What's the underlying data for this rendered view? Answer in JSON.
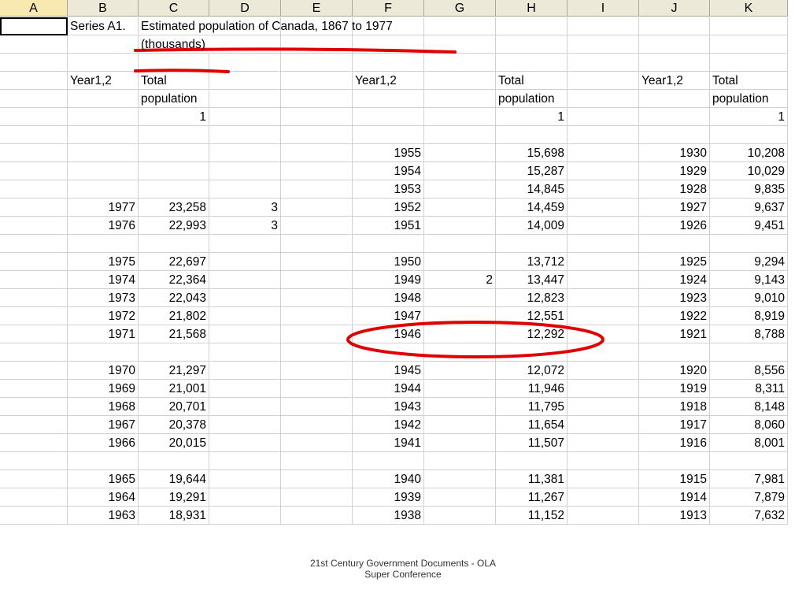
{
  "columns": [
    "A",
    "B",
    "C",
    "D",
    "E",
    "F",
    "G",
    "H",
    "I",
    "J",
    "K"
  ],
  "rows": [
    [
      "",
      "Series A1.",
      "Estimated population of Canada, 1867 to 1977",
      "",
      "",
      "",
      "",
      "",
      "",
      "",
      ""
    ],
    [
      "",
      "",
      "(thousands)",
      "",
      "",
      "",
      "",
      "",
      "",
      "",
      ""
    ],
    [
      "",
      "",
      "",
      "",
      "",
      "",
      "",
      "",
      "",
      "",
      ""
    ],
    [
      "",
      "Year1,2",
      "Total",
      "",
      "",
      "Year1,2",
      "",
      "Total",
      "",
      "Year1,2",
      "Total"
    ],
    [
      "",
      "",
      "population",
      "",
      "",
      "",
      "",
      "population",
      "",
      "",
      "population"
    ],
    [
      "",
      "",
      "1",
      "",
      "",
      "",
      "",
      "1",
      "",
      "",
      "1"
    ],
    [
      "",
      "",
      "",
      "",
      "",
      "",
      "",
      "",
      "",
      "",
      ""
    ],
    [
      "",
      "",
      "",
      "",
      "",
      "1955",
      "",
      "15,698",
      "",
      "1930",
      "10,208"
    ],
    [
      "",
      "",
      "",
      "",
      "",
      "1954",
      "",
      "15,287",
      "",
      "1929",
      "10,029"
    ],
    [
      "",
      "",
      "",
      "",
      "",
      "1953",
      "",
      "14,845",
      "",
      "1928",
      "9,835"
    ],
    [
      "",
      "1977",
      "23,258",
      "3",
      "",
      "1952",
      "",
      "14,459",
      "",
      "1927",
      "9,637"
    ],
    [
      "",
      "1976",
      "22,993",
      "3",
      "",
      "1951",
      "",
      "14,009",
      "",
      "1926",
      "9,451"
    ],
    [
      "",
      "",
      "",
      "",
      "",
      "",
      "",
      "",
      "",
      "",
      ""
    ],
    [
      "",
      "1975",
      "22,697",
      "",
      "",
      "1950",
      "",
      "13,712",
      "",
      "1925",
      "9,294"
    ],
    [
      "",
      "1974",
      "22,364",
      "",
      "",
      "1949",
      "2",
      "13,447",
      "",
      "1924",
      "9,143"
    ],
    [
      "",
      "1973",
      "22,043",
      "",
      "",
      "1948",
      "",
      "12,823",
      "",
      "1923",
      "9,010"
    ],
    [
      "",
      "1972",
      "21,802",
      "",
      "",
      "1947",
      "",
      "12,551",
      "",
      "1922",
      "8,919"
    ],
    [
      "",
      "1971",
      "21,568",
      "",
      "",
      "1946",
      "",
      "12,292",
      "",
      "1921",
      "8,788"
    ],
    [
      "",
      "",
      "",
      "",
      "",
      "",
      "",
      "",
      "",
      "",
      ""
    ],
    [
      "",
      "1970",
      "21,297",
      "",
      "",
      "1945",
      "",
      "12,072",
      "",
      "1920",
      "8,556"
    ],
    [
      "",
      "1969",
      "21,001",
      "",
      "",
      "1944",
      "",
      "11,946",
      "",
      "1919",
      "8,311"
    ],
    [
      "",
      "1968",
      "20,701",
      "",
      "",
      "1943",
      "",
      "11,795",
      "",
      "1918",
      "8,148"
    ],
    [
      "",
      "1967",
      "20,378",
      "",
      "",
      "1942",
      "",
      "11,654",
      "",
      "1917",
      "8,060"
    ],
    [
      "",
      "1966",
      "20,015",
      "",
      "",
      "1941",
      "",
      "11,507",
      "",
      "1916",
      "8,001"
    ],
    [
      "",
      "",
      "",
      "",
      "",
      "",
      "",
      "",
      "",
      "",
      ""
    ],
    [
      "",
      "1965",
      "19,644",
      "",
      "",
      "1940",
      "",
      "11,381",
      "",
      "1915",
      "7,981"
    ],
    [
      "",
      "1964",
      "19,291",
      "",
      "",
      "1939",
      "",
      "11,267",
      "",
      "1914",
      "7,879"
    ],
    [
      "",
      "1963",
      "18,931",
      "",
      "",
      "1938",
      "",
      "11,152",
      "",
      "1913",
      "7,632"
    ]
  ],
  "annotation_color": "#e00000",
  "footer": {
    "line1": "21st Century Government Documents - OLA",
    "line2": "Super Conference"
  }
}
